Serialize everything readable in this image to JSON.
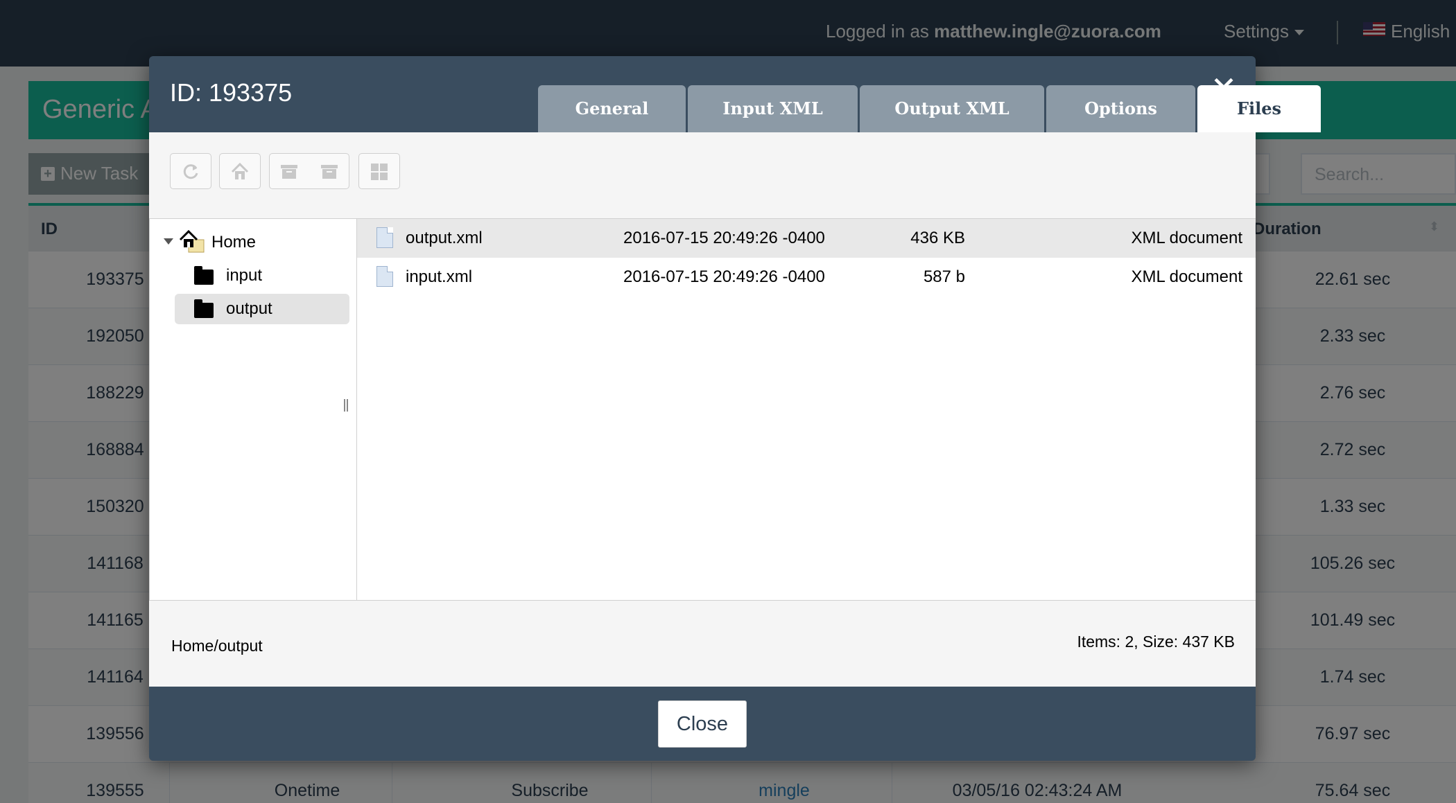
{
  "topnav": {
    "login_prefix": "Logged in as",
    "login_user": "matthew.ingle@zuora.com",
    "settings_label": "Settings",
    "language_label": "English"
  },
  "page": {
    "title": "Generic A",
    "new_task_label": "New Task",
    "search_placeholder": "Search...",
    "table": {
      "headers": {
        "id": "ID",
        "duration": "Duration"
      },
      "rows": [
        {
          "id": "193375",
          "type": "",
          "action": "",
          "user": "",
          "date": "",
          "duration": "22.61 sec"
        },
        {
          "id": "192050",
          "type": "",
          "action": "",
          "user": "",
          "date": "",
          "duration": "2.33 sec"
        },
        {
          "id": "188229",
          "type": "",
          "action": "",
          "user": "",
          "date": "",
          "duration": "2.76 sec"
        },
        {
          "id": "168884",
          "type": "",
          "action": "",
          "user": "",
          "date": "",
          "duration": "2.72 sec"
        },
        {
          "id": "150320",
          "type": "",
          "action": "",
          "user": "",
          "date": "",
          "duration": "1.33 sec"
        },
        {
          "id": "141168",
          "type": "",
          "action": "",
          "user": "",
          "date": "",
          "duration": "105.26 sec"
        },
        {
          "id": "141165",
          "type": "",
          "action": "",
          "user": "",
          "date": "",
          "duration": "101.49 sec"
        },
        {
          "id": "141164",
          "type": "",
          "action": "",
          "user": "",
          "date": "",
          "duration": "1.74 sec"
        },
        {
          "id": "139556",
          "type": "",
          "action": "",
          "user": "",
          "date": "",
          "duration": "76.97 sec"
        },
        {
          "id": "139555",
          "type": "Onetime",
          "action": "Subscribe",
          "user": "mingle",
          "date": "03/05/16 02:43:24 AM",
          "duration": "75.64 sec"
        }
      ]
    }
  },
  "modal": {
    "title": "ID: 193375",
    "tabs": [
      {
        "label": "General",
        "active": false
      },
      {
        "label": "Input XML",
        "active": false
      },
      {
        "label": "Output XML",
        "active": false
      },
      {
        "label": "Options",
        "active": false
      },
      {
        "label": "Files",
        "active": true
      }
    ],
    "toolbar": {
      "icons": [
        "refresh-icon",
        "home-icon",
        "archive-icon",
        "archive-icon",
        "grid-icon"
      ]
    },
    "tree": {
      "root": "Home",
      "children": [
        {
          "label": "input",
          "selected": false
        },
        {
          "label": "output",
          "selected": true
        }
      ]
    },
    "files": [
      {
        "name": "output.xml",
        "date": "2016-07-15 20:49:26 -0400",
        "size": "436 KB",
        "type": "XML document",
        "selected": true
      },
      {
        "name": "input.xml",
        "date": "2016-07-15 20:49:26 -0400",
        "size": "587 b",
        "type": "XML document",
        "selected": false
      }
    ],
    "status": {
      "path": "Home/output",
      "summary": "Items: 2, Size: 437 KB"
    },
    "close_label": "Close"
  },
  "colors": {
    "navbar": "#2c3e50",
    "accent": "#18bc9c",
    "modal_header": "#3a4d5f",
    "tab_inactive": "#8c9aa6",
    "link": "#2c7fb8"
  }
}
